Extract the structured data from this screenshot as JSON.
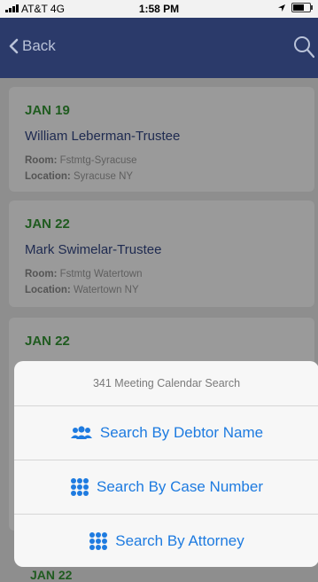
{
  "status_bar": {
    "carrier": "AT&T 4G",
    "time": "1:58 PM"
  },
  "nav": {
    "back_label": "Back"
  },
  "meetings": [
    {
      "date": "JAN 19",
      "name": "William Leberman-Trustee",
      "room_label": "Room:",
      "room": "Fstmtg-Syracuse",
      "location_label": "Location:",
      "location": "Syracuse NY"
    },
    {
      "date": "JAN 22",
      "name": "Mark Swimelar-Trustee",
      "room_label": "Room:",
      "room": "Fstmtg Watertown",
      "location_label": "Location:",
      "location": "Watertown NY"
    },
    {
      "date": "JAN 22"
    }
  ],
  "action_sheet": {
    "title": "341 Meeting Calendar Search",
    "options": [
      {
        "label": "Search By Debtor Name",
        "icon": "people-icon"
      },
      {
        "label": "Search By Case Number",
        "icon": "grid-dots-icon"
      },
      {
        "label": "Search By Attorney",
        "icon": "grid-dots-icon"
      }
    ]
  },
  "peek_date": "JAN 22",
  "colors": {
    "nav": "#2b3a6a",
    "date_green": "#1f5b1f",
    "action_blue": "#1e7be0"
  }
}
